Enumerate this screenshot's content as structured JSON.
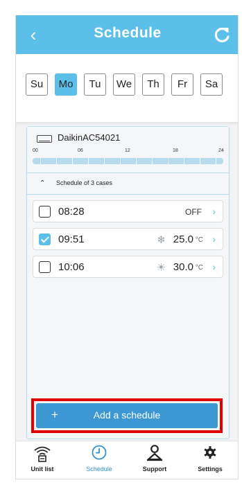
{
  "header": {
    "title": "Schedule",
    "back_icon": "chevron-left-icon",
    "refresh_icon": "refresh-icon"
  },
  "days": [
    {
      "label": "Su",
      "selected": false
    },
    {
      "label": "Mo",
      "selected": true
    },
    {
      "label": "Tu",
      "selected": false
    },
    {
      "label": "We",
      "selected": false
    },
    {
      "label": "Th",
      "selected": false
    },
    {
      "label": "Fr",
      "selected": false
    },
    {
      "label": "Sa",
      "selected": false
    }
  ],
  "unit": {
    "name": "DaikinAC54021",
    "icon": "air-conditioner-icon",
    "timeline_ticks": [
      "00",
      "06",
      "12",
      "18",
      "24"
    ]
  },
  "schedule_summary": "Schedule of 3 cases",
  "schedules": [
    {
      "time": "08:28",
      "enabled": false,
      "status": "OFF",
      "mode": "",
      "temp": "",
      "unit": ""
    },
    {
      "time": "09:51",
      "enabled": true,
      "status": "",
      "mode": "snowflake-icon",
      "temp": "25.0",
      "unit": "°C"
    },
    {
      "time": "10:06",
      "enabled": false,
      "status": "",
      "mode": "sun-icon",
      "temp": "30.0",
      "unit": "°C"
    }
  ],
  "add_button": {
    "plus": "+",
    "label": "Add a schedule"
  },
  "tabs": [
    {
      "label": "Unit list",
      "icon": "wifi-unit-icon",
      "active": false
    },
    {
      "label": "Schedule",
      "icon": "clock-icon",
      "active": true
    },
    {
      "label": "Support",
      "icon": "support-icon",
      "active": false
    },
    {
      "label": "Settings",
      "icon": "gear-icon",
      "active": false
    }
  ],
  "colors": {
    "accent": "#5bbfe9",
    "button": "#3c97d3",
    "highlight": "#e00000"
  }
}
